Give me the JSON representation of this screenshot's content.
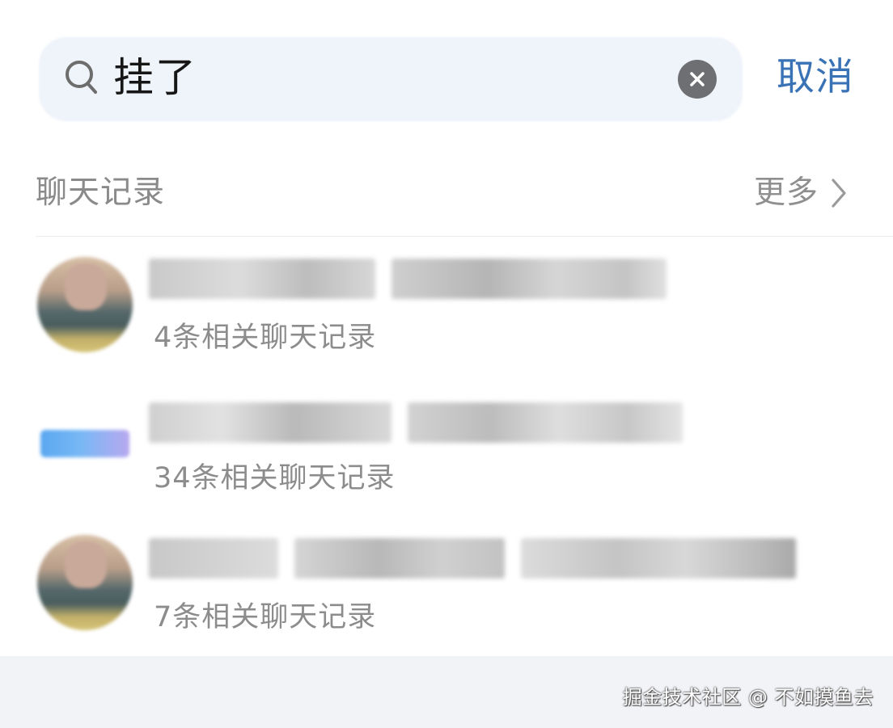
{
  "search": {
    "query": "挂了",
    "cancel_label": "取消"
  },
  "section": {
    "title": "聊天记录",
    "more_label": "更多"
  },
  "results": [
    {
      "subtitle": "4条相关聊天记录"
    },
    {
      "subtitle": "34条相关聊天记录"
    },
    {
      "subtitle": "7条相关聊天记录"
    }
  ],
  "watermark": "掘金技术社区 @ 不如摸鱼去",
  "colors": {
    "accent": "#3a72b6",
    "search_bg": "#eff3fa",
    "secondary_text": "#8c8c8c",
    "bottom_bar": "#f2f3f7"
  }
}
